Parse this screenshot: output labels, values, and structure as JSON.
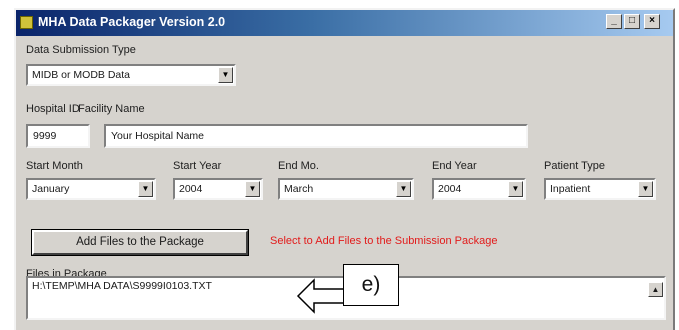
{
  "window": {
    "title": "MHA Data Packager Version 2.0",
    "min_glyph": "_",
    "max_glyph": "□",
    "close_glyph": "×"
  },
  "submission": {
    "label": "Data Submission Type",
    "value": "MIDB or MODB Data"
  },
  "hospital": {
    "id_label": "Hospital ID",
    "id_value": "9999",
    "name_label": "Facility Name",
    "name_value": "Your Hospital Name"
  },
  "period": {
    "start_month_label": "Start Month",
    "start_month_value": "January",
    "start_year_label": "Start Year",
    "start_year_value": "2004",
    "end_month_label": "End Mo.",
    "end_month_value": "March",
    "end_year_label": "End Year",
    "end_year_value": "2004",
    "patient_type_label": "Patient Type",
    "patient_type_value": "Inpatient"
  },
  "actions": {
    "add_files_label": "Add Files to the Package",
    "hint": "Select to Add Files to the Submission Package"
  },
  "files": {
    "label": "Files in Package",
    "items": [
      "H:\\TEMP\\MHA DATA\\S9999I0103.TXT"
    ]
  },
  "annotation": {
    "label": "e)"
  },
  "icons": {
    "dropdown": "▼",
    "scroll_up": "▲"
  }
}
